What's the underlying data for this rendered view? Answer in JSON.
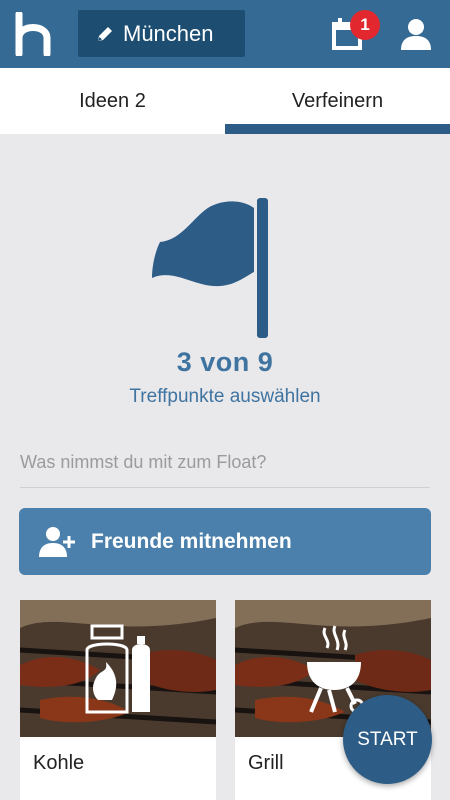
{
  "header": {
    "city_label": "München",
    "notification_count": "1"
  },
  "tabs": [
    {
      "label": "Ideen 2"
    },
    {
      "label": "Verfeinern"
    }
  ],
  "progress": {
    "count_text": "3 von 9",
    "subtitle": "Treffpunkte auswählen",
    "selected": 3,
    "total": 9
  },
  "question": "Was nimmst du mit zum Float?",
  "friends_button": {
    "label": "Freunde mitnehmen"
  },
  "items": [
    {
      "label": "Kohle",
      "icon": "gas-bottles-icon"
    },
    {
      "label": "Grill",
      "icon": "grill-icon"
    }
  ],
  "start_button": {
    "label": "START"
  },
  "colors": {
    "primary": "#346a93",
    "dark": "#1d4e72",
    "accent_text": "#3f73a0",
    "badge": "#e2282e"
  }
}
